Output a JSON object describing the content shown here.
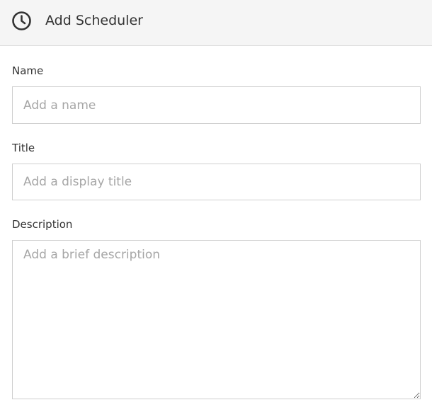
{
  "header": {
    "title": "Add Scheduler",
    "icon": "clock-icon"
  },
  "form": {
    "name": {
      "label": "Name",
      "placeholder": "Add a name",
      "value": ""
    },
    "title": {
      "label": "Title",
      "placeholder": "Add a display title",
      "value": ""
    },
    "description": {
      "label": "Description",
      "placeholder": "Add a brief description",
      "value": ""
    }
  },
  "colors": {
    "header_bg": "#f5f5f5",
    "border": "#cfcfcf",
    "text": "#333333",
    "placeholder": "#a6a6a6"
  }
}
